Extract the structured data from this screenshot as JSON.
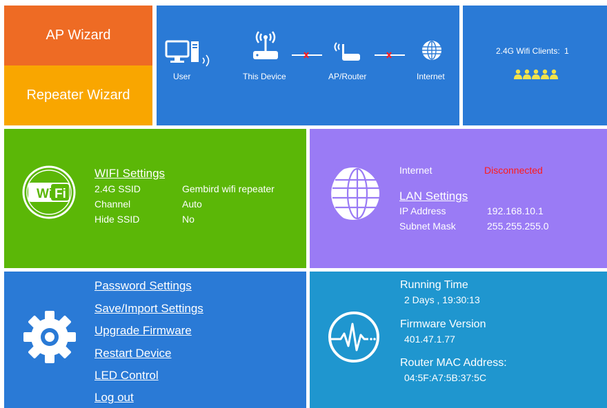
{
  "wizards": {
    "ap_wizard": "AP Wizard",
    "repeater_wizard": "Repeater Wizard"
  },
  "topology": {
    "user": "User",
    "this_device": "This Device",
    "ap_router": "AP/Router",
    "internet": "Internet"
  },
  "clients": {
    "label": "2.4G Wifi Clients:",
    "count": "1",
    "icons": "users-icon"
  },
  "wifi": {
    "title": "WIFI Settings",
    "ssid_label": "2.4G SSID",
    "ssid_value": "Gembird wifi repeater",
    "channel_label": "Channel",
    "channel_value": "Auto",
    "hide_label": "Hide SSID",
    "hide_value": "No"
  },
  "lan": {
    "internet_label": "Internet",
    "internet_status": "Disconnected",
    "title": "LAN Settings",
    "ip_label": "IP Address",
    "ip_value": "192.168.10.1",
    "mask_label": "Subnet Mask",
    "mask_value": "255.255.255.0"
  },
  "menu": {
    "password": "Password Settings",
    "save_import": "Save/Import Settings",
    "upgrade": "Upgrade Firmware",
    "restart": "Restart Device",
    "led": "LED Control",
    "logout": "Log out"
  },
  "status": {
    "running_label": "Running Time",
    "running_value": "2 Days , 19:30:13",
    "firmware_label": "Firmware Version",
    "firmware_value": "401.47.1.77",
    "mac_label": "Router MAC Address:",
    "mac_value": "04:5F:A7:5B:37:5C"
  },
  "colors": {
    "orange": "#ee6b24",
    "amber": "#f9a600",
    "blue": "#2a7ad6",
    "green": "#5bb707",
    "purple": "#9a7bf5",
    "teal": "#1f96cf",
    "disconnected": "#ff1a1a",
    "clients_icon": "#f2e34a"
  }
}
